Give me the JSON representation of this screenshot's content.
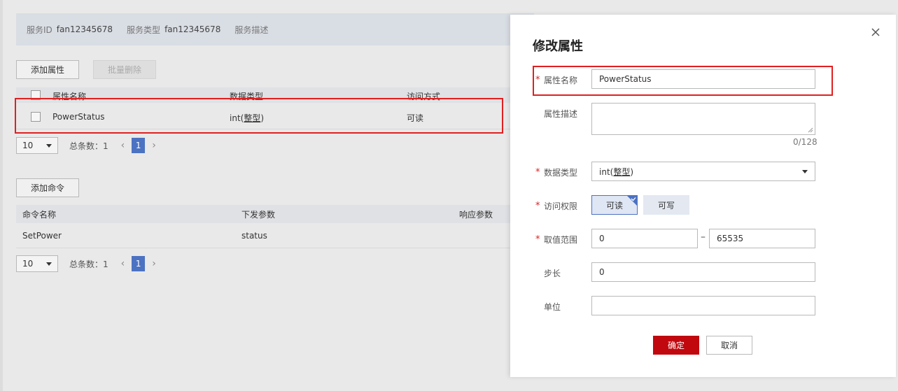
{
  "service_info": {
    "id_label": "服务ID",
    "id_value": "fan12345678",
    "type_label": "服务类型",
    "type_value": "fan12345678",
    "desc_label": "服务描述"
  },
  "properties": {
    "add_button": "添加属性",
    "batch_delete_button": "批量删除",
    "columns": [
      "属性名称",
      "数据类型",
      "访问方式"
    ],
    "rows": [
      {
        "name": "PowerStatus",
        "type_prefix": "int(",
        "type_word": "整型",
        "type_suffix": ")",
        "access": "可读"
      }
    ],
    "pager": {
      "page_size": "10",
      "total": "总条数：1",
      "current_page": "1",
      "prev": "‹",
      "next": "›"
    }
  },
  "commands": {
    "add_button": "添加命令",
    "columns": [
      "命令名称",
      "下发参数",
      "响应参数"
    ],
    "rows": [
      {
        "name": "SetPower",
        "param": "status",
        "response": ""
      }
    ],
    "pager": {
      "page_size": "10",
      "total": "总条数：1",
      "current_page": "1",
      "prev": "‹",
      "next": "›"
    }
  },
  "dialog": {
    "title": "修改属性",
    "required_mark": "*",
    "fields": {
      "name_label": "属性名称",
      "name_value": "PowerStatus",
      "desc_label": "属性描述",
      "desc_value": "",
      "desc_counter": "0/128",
      "data_type_label": "数据类型",
      "data_type_prefix": "int(",
      "data_type_word": "整型",
      "data_type_suffix": ")",
      "access_label": "访问权限",
      "access_read": "可读",
      "access_write": "可写",
      "range_label": "取值范围",
      "range_min": "0",
      "range_dash": "–",
      "range_max": "65535",
      "step_label": "步长",
      "step_value": "0",
      "unit_label": "单位",
      "unit_value": ""
    },
    "ok_button": "确定",
    "cancel_button": "取消"
  },
  "colors": {
    "accent": "#4c72c2",
    "danger": "#c1080f",
    "highlight": "#e02020"
  },
  "icons": [
    "close-icon",
    "chevron-down-icon",
    "resize-grip-icon",
    "check-corner-icon",
    "chevron-left-icon",
    "chevron-right-icon"
  ]
}
